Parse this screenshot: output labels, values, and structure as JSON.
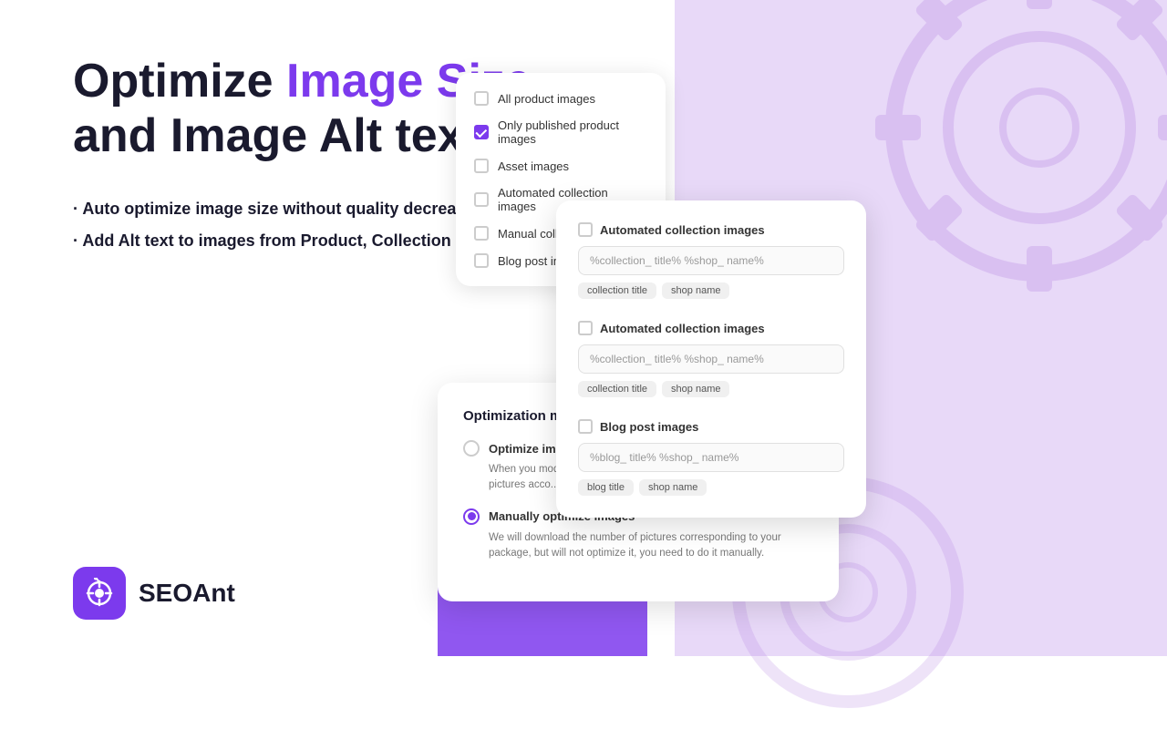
{
  "left": {
    "title_part1": "Optimize ",
    "title_highlight": "Image Size",
    "title_part2": " and Image Alt text",
    "features": [
      "· Auto optimize image size without quality decreasing.",
      "· Add Alt text to images from Product, Collection and Blog pages"
    ],
    "logo_text": "SEOAnt"
  },
  "checkboxes": {
    "items": [
      {
        "label": "All product images",
        "checked": false
      },
      {
        "label": "Only published product images",
        "checked": true
      },
      {
        "label": "Asset images",
        "checked": false
      },
      {
        "label": "Automated collection images",
        "checked": false
      },
      {
        "label": "Manual collection image",
        "checked": false
      },
      {
        "label": "Blog post images",
        "checked": false
      }
    ]
  },
  "alttext": {
    "sections": [
      {
        "title": "Automated collection images",
        "input_value": "%collection_ title% %shop_ name%",
        "tags": [
          "collection title",
          "shop name"
        ]
      },
      {
        "title": "Automated collection images",
        "input_value": "%collection_ title% %shop_ name%",
        "tags": [
          "collection title",
          "shop name"
        ]
      },
      {
        "title": "Blog post images",
        "input_value": "%blog_ title% %shop_ name%",
        "tags": [
          "blog title",
          "shop name"
        ]
      }
    ]
  },
  "optimization": {
    "title": "Optimization mode",
    "options": [
      {
        "label": "Optimize images automatically",
        "desc": "When you modify the products/assets/co... automatically optimize the pictures acco...",
        "selected": false
      },
      {
        "label": "Manually optimize images",
        "desc": "We will download the number of pictures corresponding to your package, but will not optimize it, you need to do it manually.",
        "selected": true
      }
    ]
  }
}
